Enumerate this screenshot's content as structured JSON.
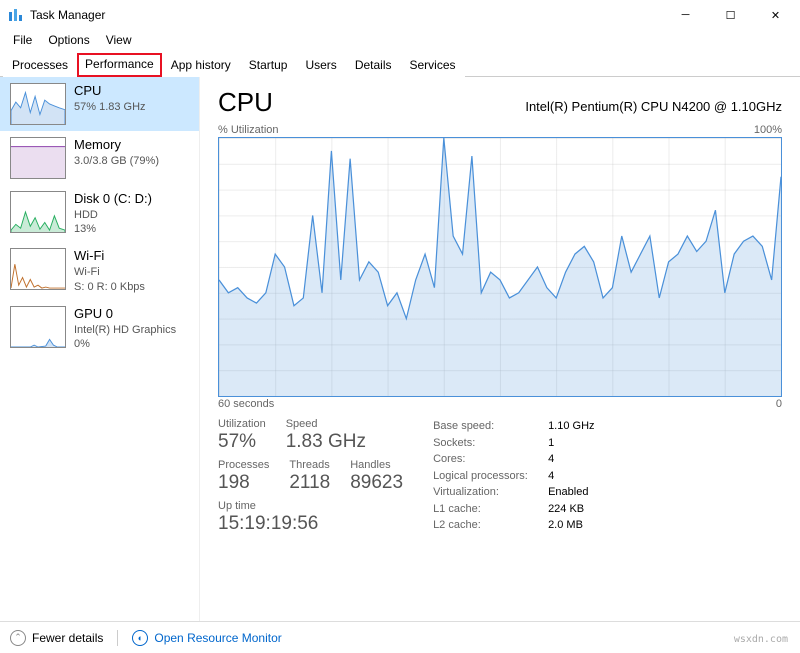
{
  "window": {
    "title": "Task Manager",
    "menu": [
      "File",
      "Options",
      "View"
    ]
  },
  "tabs": {
    "items": [
      "Processes",
      "Performance",
      "App history",
      "Startup",
      "Users",
      "Details",
      "Services"
    ],
    "active": "Performance"
  },
  "sidebar": [
    {
      "title": "CPU",
      "sub": "57%  1.83 GHz",
      "color": "#4a90d9",
      "selected": true,
      "spark": [
        35,
        55,
        40,
        80,
        30,
        70,
        25,
        60,
        50,
        45,
        40,
        35
      ]
    },
    {
      "title": "Memory",
      "sub": "3.0/3.8 GB (79%)",
      "color": "#9b59b6",
      "selected": false,
      "spark": [
        79,
        79,
        79,
        79,
        79,
        79,
        79,
        79,
        79,
        79,
        79,
        79
      ]
    },
    {
      "title": "Disk 0 (C: D:)",
      "sub1": "HDD",
      "sub2": "13%",
      "color": "#27ae60",
      "selected": false,
      "spark": [
        5,
        20,
        10,
        50,
        15,
        35,
        8,
        25,
        5,
        40,
        10,
        5
      ]
    },
    {
      "title": "Wi-Fi",
      "sub1": "Wi-Fi",
      "sub2": "S: 0 R: 0 Kbps",
      "color": "#c0702c",
      "selected": false,
      "spark": [
        2,
        60,
        10,
        30,
        5,
        20,
        5,
        8,
        3,
        5,
        2,
        2
      ]
    },
    {
      "title": "GPU 0",
      "sub1": "Intel(R) HD Graphics",
      "sub2": "0%",
      "color": "#4a90d9",
      "selected": false,
      "spark": [
        0,
        0,
        0,
        0,
        5,
        0,
        0,
        0,
        2,
        18,
        5,
        0
      ]
    }
  ],
  "detail": {
    "title": "CPU",
    "model": "Intel(R) Pentium(R) CPU N4200 @ 1.10GHz",
    "ytop_label": "% Utilization",
    "ytop_value": "100%",
    "xleft": "60 seconds",
    "xright": "0"
  },
  "stats_left": [
    [
      {
        "label": "Utilization",
        "value": "57%"
      },
      {
        "label": "Speed",
        "value": "1.83 GHz"
      }
    ],
    [
      {
        "label": "Processes",
        "value": "198"
      },
      {
        "label": "Threads",
        "value": "2118"
      },
      {
        "label": "Handles",
        "value": "89623"
      }
    ]
  ],
  "uptime_label": "Up time",
  "uptime_value": "15:19:19:56",
  "stats_right": [
    {
      "k": "Base speed:",
      "v": "1.10 GHz"
    },
    {
      "k": "Sockets:",
      "v": "1"
    },
    {
      "k": "Cores:",
      "v": "4"
    },
    {
      "k": "Logical processors:",
      "v": "4"
    },
    {
      "k": "Virtualization:",
      "v": "Enabled"
    },
    {
      "k": "L1 cache:",
      "v": "224 KB"
    },
    {
      "k": "L2 cache:",
      "v": "2.0 MB"
    }
  ],
  "bottom": {
    "fewer": "Fewer details",
    "orm": "Open Resource Monitor"
  },
  "watermark": "wsxdn.com",
  "chart_data": {
    "type": "line",
    "title": "CPU % Utilization",
    "ylabel": "% Utilization",
    "xlabel": "seconds",
    "ylim": [
      0,
      100
    ],
    "xlim": [
      60,
      0
    ],
    "x": [
      60,
      59,
      58,
      57,
      56,
      55,
      54,
      53,
      52,
      51,
      50,
      49,
      48,
      47,
      46,
      45,
      44,
      43,
      42,
      41,
      40,
      39,
      38,
      37,
      36,
      35,
      34,
      33,
      32,
      31,
      30,
      29,
      28,
      27,
      26,
      25,
      24,
      23,
      22,
      21,
      20,
      19,
      18,
      17,
      16,
      15,
      14,
      13,
      12,
      11,
      10,
      9,
      8,
      7,
      6,
      5,
      4,
      3,
      2,
      1,
      0
    ],
    "values": [
      45,
      40,
      42,
      38,
      36,
      40,
      55,
      50,
      35,
      38,
      70,
      40,
      95,
      45,
      92,
      45,
      52,
      48,
      35,
      40,
      30,
      45,
      55,
      42,
      100,
      62,
      55,
      93,
      40,
      48,
      45,
      38,
      40,
      45,
      50,
      42,
      38,
      48,
      55,
      58,
      52,
      38,
      42,
      62,
      48,
      55,
      62,
      38,
      52,
      55,
      62,
      56,
      60,
      72,
      40,
      55,
      60,
      62,
      58,
      45,
      85
    ]
  }
}
